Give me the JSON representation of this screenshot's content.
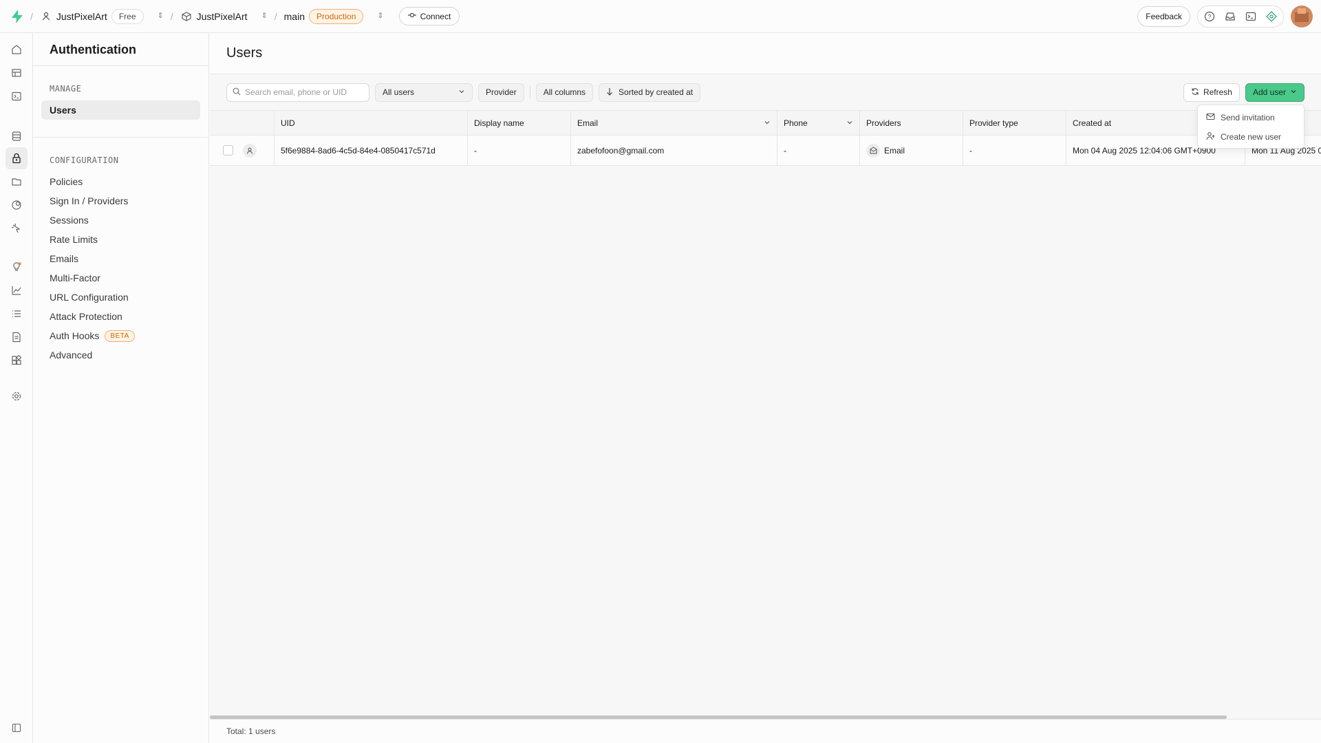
{
  "topbar": {
    "org_name": "JustPixelArt",
    "plan": "Free",
    "project_name": "JustPixelArt",
    "branch": "main",
    "env": "Production",
    "connect_label": "Connect",
    "feedback_label": "Feedback",
    "separator": "/"
  },
  "sidebar": {
    "title": "Authentication",
    "manage_label": "MANAGE",
    "manage_items": [
      "Users"
    ],
    "config_label": "CONFIGURATION",
    "config_items": [
      "Policies",
      "Sign In / Providers",
      "Sessions",
      "Rate Limits",
      "Emails",
      "Multi-Factor",
      "URL Configuration",
      "Attack Protection",
      "Auth Hooks",
      "Advanced"
    ],
    "beta_badge": "BETA"
  },
  "main": {
    "title": "Users",
    "search_placeholder": "Search email, phone or UID",
    "filter_users": "All users",
    "provider_btn": "Provider",
    "columns_btn": "All columns",
    "sort_btn": "Sorted by created at",
    "refresh_btn": "Refresh",
    "add_user_btn": "Add user",
    "add_user_menu": [
      "Send invitation",
      "Create new user"
    ],
    "columns": [
      "UID",
      "Display name",
      "Email",
      "Phone",
      "Providers",
      "Provider type",
      "Created at"
    ],
    "rows": [
      {
        "uid": "5f6e9884-8ad6-4c5d-84e4-0850417c571d",
        "display_name": "-",
        "email": "zabefofoon@gmail.com",
        "phone": "-",
        "provider": "Email",
        "provider_type": "-",
        "created_at": "Mon 04 Aug 2025 12:04:06 GMT+0900",
        "last_col": "Mon 11 Aug 2025 0"
      }
    ],
    "total": "Total: 1 users"
  },
  "colors": {
    "accent": "#4ac98a",
    "production": "#c86a10"
  }
}
